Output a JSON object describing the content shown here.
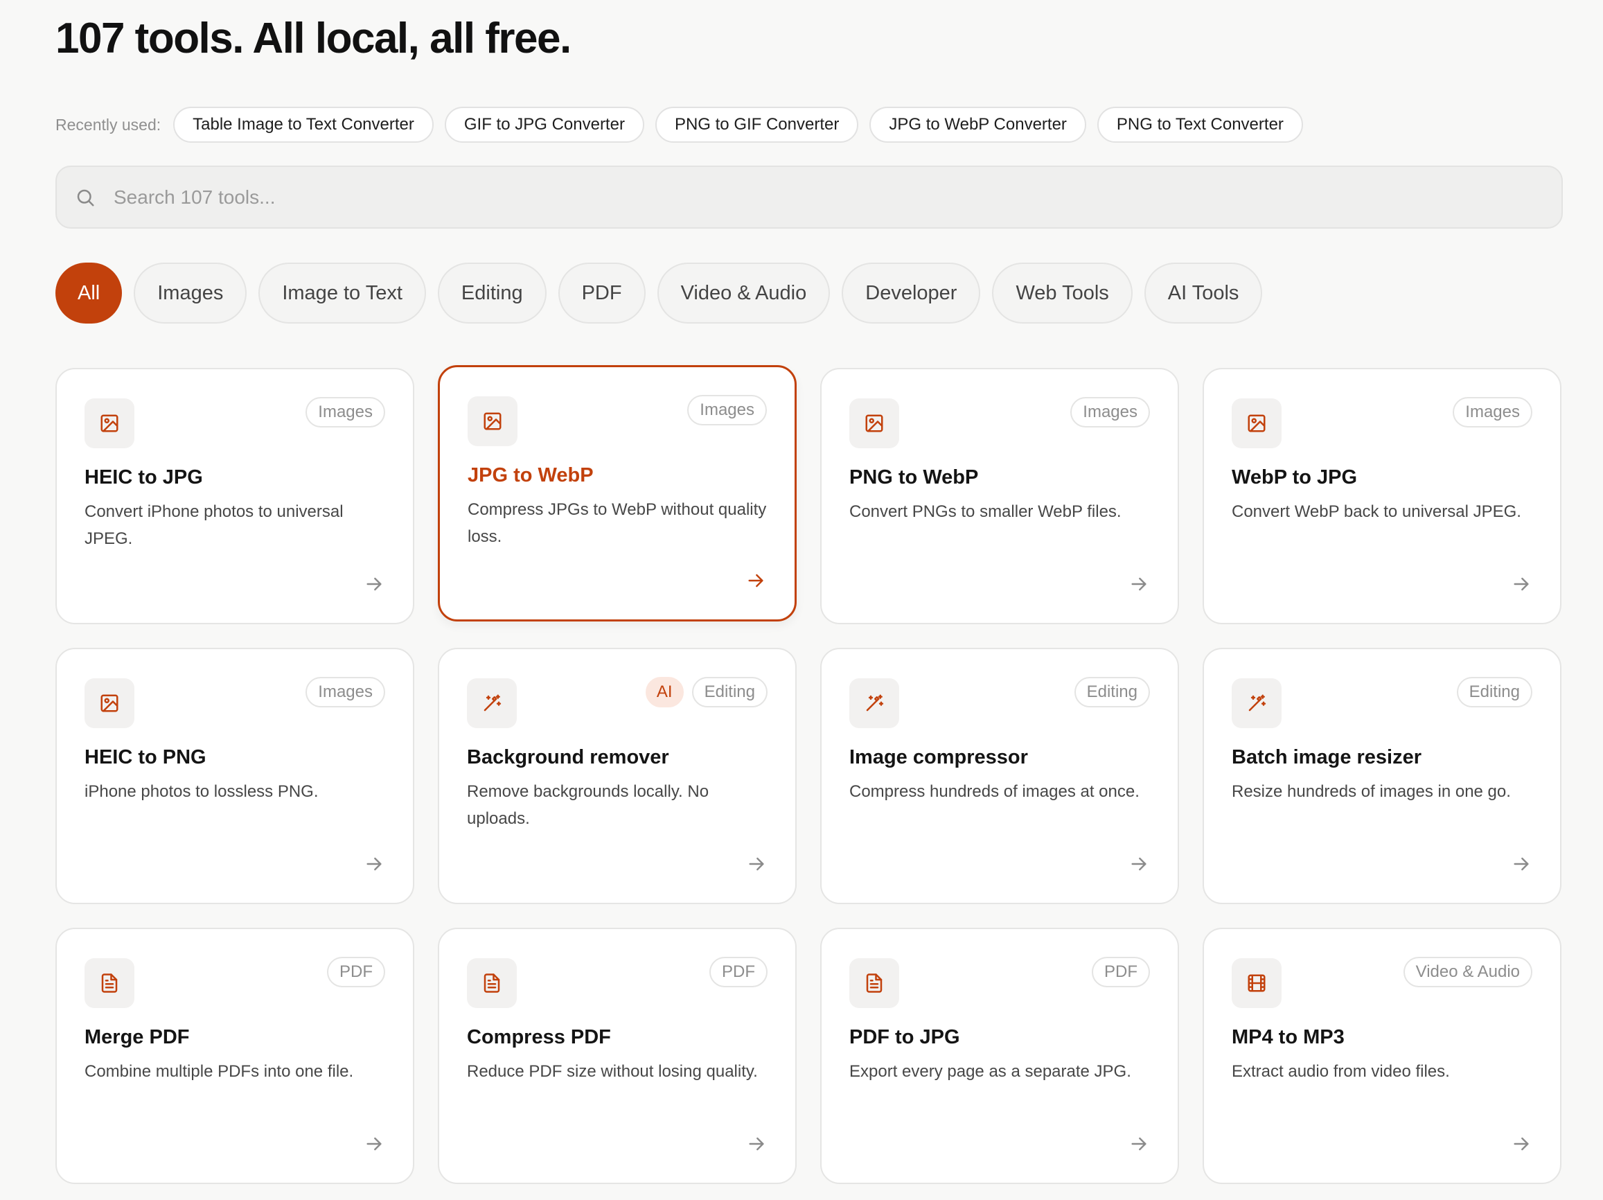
{
  "headline": "107 tools. All local, all free.",
  "recent": {
    "label": "Recently used:",
    "items": [
      "Table Image to Text Converter",
      "GIF to JPG Converter",
      "PNG to GIF Converter",
      "JPG to WebP Converter",
      "PNG to Text Converter"
    ]
  },
  "search": {
    "placeholder": "Search 107 tools..."
  },
  "filters": [
    {
      "label": "All",
      "active": true
    },
    {
      "label": "Images"
    },
    {
      "label": "Image to Text"
    },
    {
      "label": "Editing"
    },
    {
      "label": "PDF"
    },
    {
      "label": "Video & Audio"
    },
    {
      "label": "Developer"
    },
    {
      "label": "Web Tools"
    },
    {
      "label": "AI Tools"
    }
  ],
  "accent_color": "#c2410c",
  "tools": [
    {
      "title": "HEIC to JPG",
      "desc": "Convert iPhone photos to universal JPEG.",
      "tags": [
        "Images"
      ],
      "icon": "image-icon"
    },
    {
      "title": "JPG to WebP",
      "desc": "Compress JPGs to WebP without quality loss.",
      "tags": [
        "Images"
      ],
      "icon": "image-icon",
      "highlight": true
    },
    {
      "title": "PNG to WebP",
      "desc": "Convert PNGs to smaller WebP files.",
      "tags": [
        "Images"
      ],
      "icon": "image-icon"
    },
    {
      "title": "WebP to JPG",
      "desc": "Convert WebP back to universal JPEG.",
      "tags": [
        "Images"
      ],
      "icon": "image-icon"
    },
    {
      "title": "HEIC to PNG",
      "desc": "iPhone photos to lossless PNG.",
      "tags": [
        "Images"
      ],
      "icon": "image-icon"
    },
    {
      "title": "Background remover",
      "desc": "Remove backgrounds locally. No uploads.",
      "tags": [
        "AI",
        "Editing"
      ],
      "icon": "magic-wand-icon"
    },
    {
      "title": "Image compressor",
      "desc": "Compress hundreds of images at once.",
      "tags": [
        "Editing"
      ],
      "icon": "magic-wand-icon"
    },
    {
      "title": "Batch image resizer",
      "desc": "Resize hundreds of images in one go.",
      "tags": [
        "Editing"
      ],
      "icon": "magic-wand-icon"
    },
    {
      "title": "Merge PDF",
      "desc": "Combine multiple PDFs into one file.",
      "tags": [
        "PDF"
      ],
      "icon": "document-icon"
    },
    {
      "title": "Compress PDF",
      "desc": "Reduce PDF size without losing quality.",
      "tags": [
        "PDF"
      ],
      "icon": "document-icon"
    },
    {
      "title": "PDF to JPG",
      "desc": "Export every page as a separate JPG.",
      "tags": [
        "PDF"
      ],
      "icon": "document-icon"
    },
    {
      "title": "MP4 to MP3",
      "desc": "Extract audio from video files.",
      "tags": [
        "Video & Audio"
      ],
      "icon": "film-icon"
    }
  ]
}
